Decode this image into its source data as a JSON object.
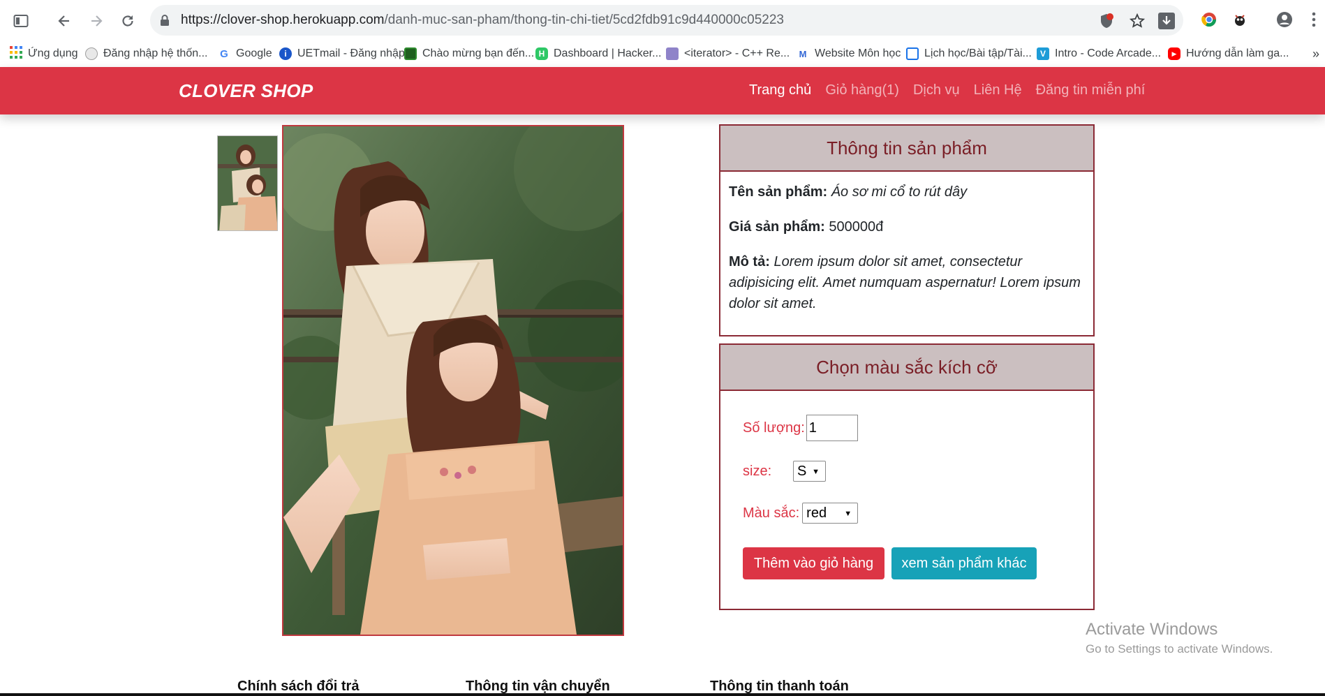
{
  "browser": {
    "url_host": "https://clover-shop.herokuapp.com",
    "url_path": "/danh-muc-san-pham/thong-tin-chi-tiet/5cd2fdb91c9d440000c05223"
  },
  "bookmarks": [
    {
      "label": "Ứng dụng",
      "icon": "apps-grid-icon",
      "color": "#4285f4"
    },
    {
      "label": "Đăng nhập hệ thốn...",
      "icon": "globe-icon",
      "color": "#9e9e9e"
    },
    {
      "label": "Google",
      "icon": "google-icon",
      "color": "#4285f4"
    },
    {
      "label": "UETmail - Đăng nhập",
      "icon": "info-icon",
      "color": "#1a56c9"
    },
    {
      "label": "Chào mừng bạn đến...",
      "icon": "course-icon",
      "color": "#1f7a1f"
    },
    {
      "label": "Dashboard | Hacker...",
      "icon": "hackerrank-icon",
      "color": "#2ec866"
    },
    {
      "label": "<iterator> - C++ Re...",
      "icon": "cpp-icon",
      "color": "#6a5acd"
    },
    {
      "label": "Website Môn học",
      "icon": "website-icon",
      "color": "#3367d6"
    },
    {
      "label": "Lịch học/Bài tập/Tài...",
      "icon": "calendar-icon",
      "color": "#1a73e8"
    },
    {
      "label": "Intro - Code Arcade...",
      "icon": "codesignal-icon",
      "color": "#1e9cd7"
    },
    {
      "label": "Hướng dẫn làm ga...",
      "icon": "youtube-icon",
      "color": "#ff0000"
    }
  ],
  "site": {
    "brand": "CLOVER SHOP",
    "nav": [
      "Trang chủ",
      "Giỏ hàng(1)",
      "Dịch vụ",
      "Liên Hệ",
      "Đăng tin miễn phí"
    ]
  },
  "product_info": {
    "header": "Thông tin sản phẩm",
    "name_label": "Tên sản phẩm:",
    "name_value": "Áo sơ mi cổ to rút dây",
    "price_label": "Giá sản phẩm:",
    "price_value": "500000đ",
    "desc_label": "Mô tả:",
    "desc_value": "Lorem ipsum dolor sit amet, consectetur adipisicing elit. Amet numquam aspernatur! Lorem ipsum dolor sit amet."
  },
  "options": {
    "header": "Chọn màu sắc kích cỡ",
    "qty_label": "Số lượng:",
    "qty_value": "1",
    "size_label": "size:",
    "size_value": "S",
    "color_label": "Màu sắc:",
    "color_value": "red",
    "add_button": "Thêm vào giỏ hàng",
    "more_button": "xem sản phẩm khác"
  },
  "watermark": {
    "title": "Activate Windows",
    "subtitle": "Go to Settings to activate Windows."
  },
  "footer": [
    "Chính sách đổi trả",
    "Thông tin vận chuyển",
    "Thông tin thanh toán"
  ]
}
